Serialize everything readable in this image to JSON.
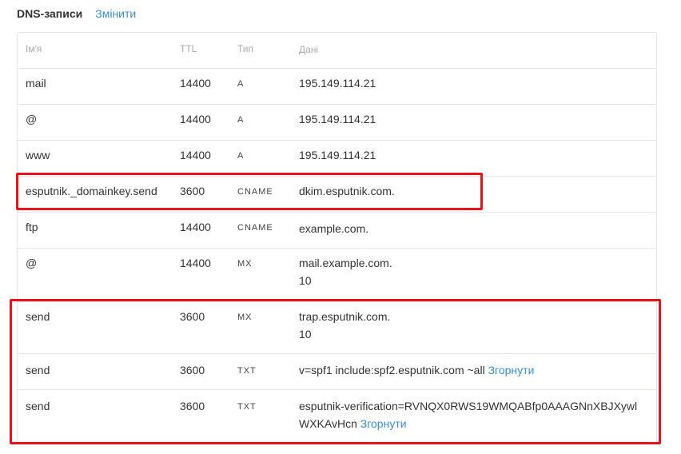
{
  "section": {
    "title": "DNS-записи",
    "edit_label": "Змінити"
  },
  "table": {
    "columns": [
      "Ім'я",
      "TTL",
      "Тип",
      "Дані"
    ],
    "rows": [
      {
        "name": "mail",
        "ttl": "14400",
        "type": "A",
        "data": "195.149.114.21"
      },
      {
        "name": "@",
        "ttl": "14400",
        "type": "A",
        "data": "195.149.114.21"
      },
      {
        "name": "www",
        "ttl": "14400",
        "type": "A",
        "data": "195.149.114.21"
      },
      {
        "name": "esputnik._domainkey.send",
        "ttl": "3600",
        "type": "CNAME",
        "data": "dkim.esputnik.com."
      },
      {
        "name": "ftp",
        "ttl": "14400",
        "type": "CNAME",
        "data": "example.com."
      },
      {
        "name": "@",
        "ttl": "14400",
        "type": "MX",
        "data": "mail.example.com.",
        "priority": "10"
      },
      {
        "name": "send",
        "ttl": "3600",
        "type": "MX",
        "data": "trap.esputnik.com.",
        "priority": "10"
      },
      {
        "name": "send",
        "ttl": "3600",
        "type": "TXT",
        "data": "v=spf1 include:spf2.esputnik.com ~all",
        "link": "Згорнути"
      },
      {
        "name": "send",
        "ttl": "3600",
        "type": "TXT",
        "data_line1": "esputnik-verification=RVNQX0RWS19WMQABfp0AAAGNnXBJXywl",
        "data_line2": "WXKAvHcn",
        "link": "Згорнути"
      }
    ]
  },
  "colors": {
    "link": "#3a8fd1",
    "highlight": "#e8141c",
    "border": "#e6e6e6",
    "header_text": "#aaaaaa"
  }
}
